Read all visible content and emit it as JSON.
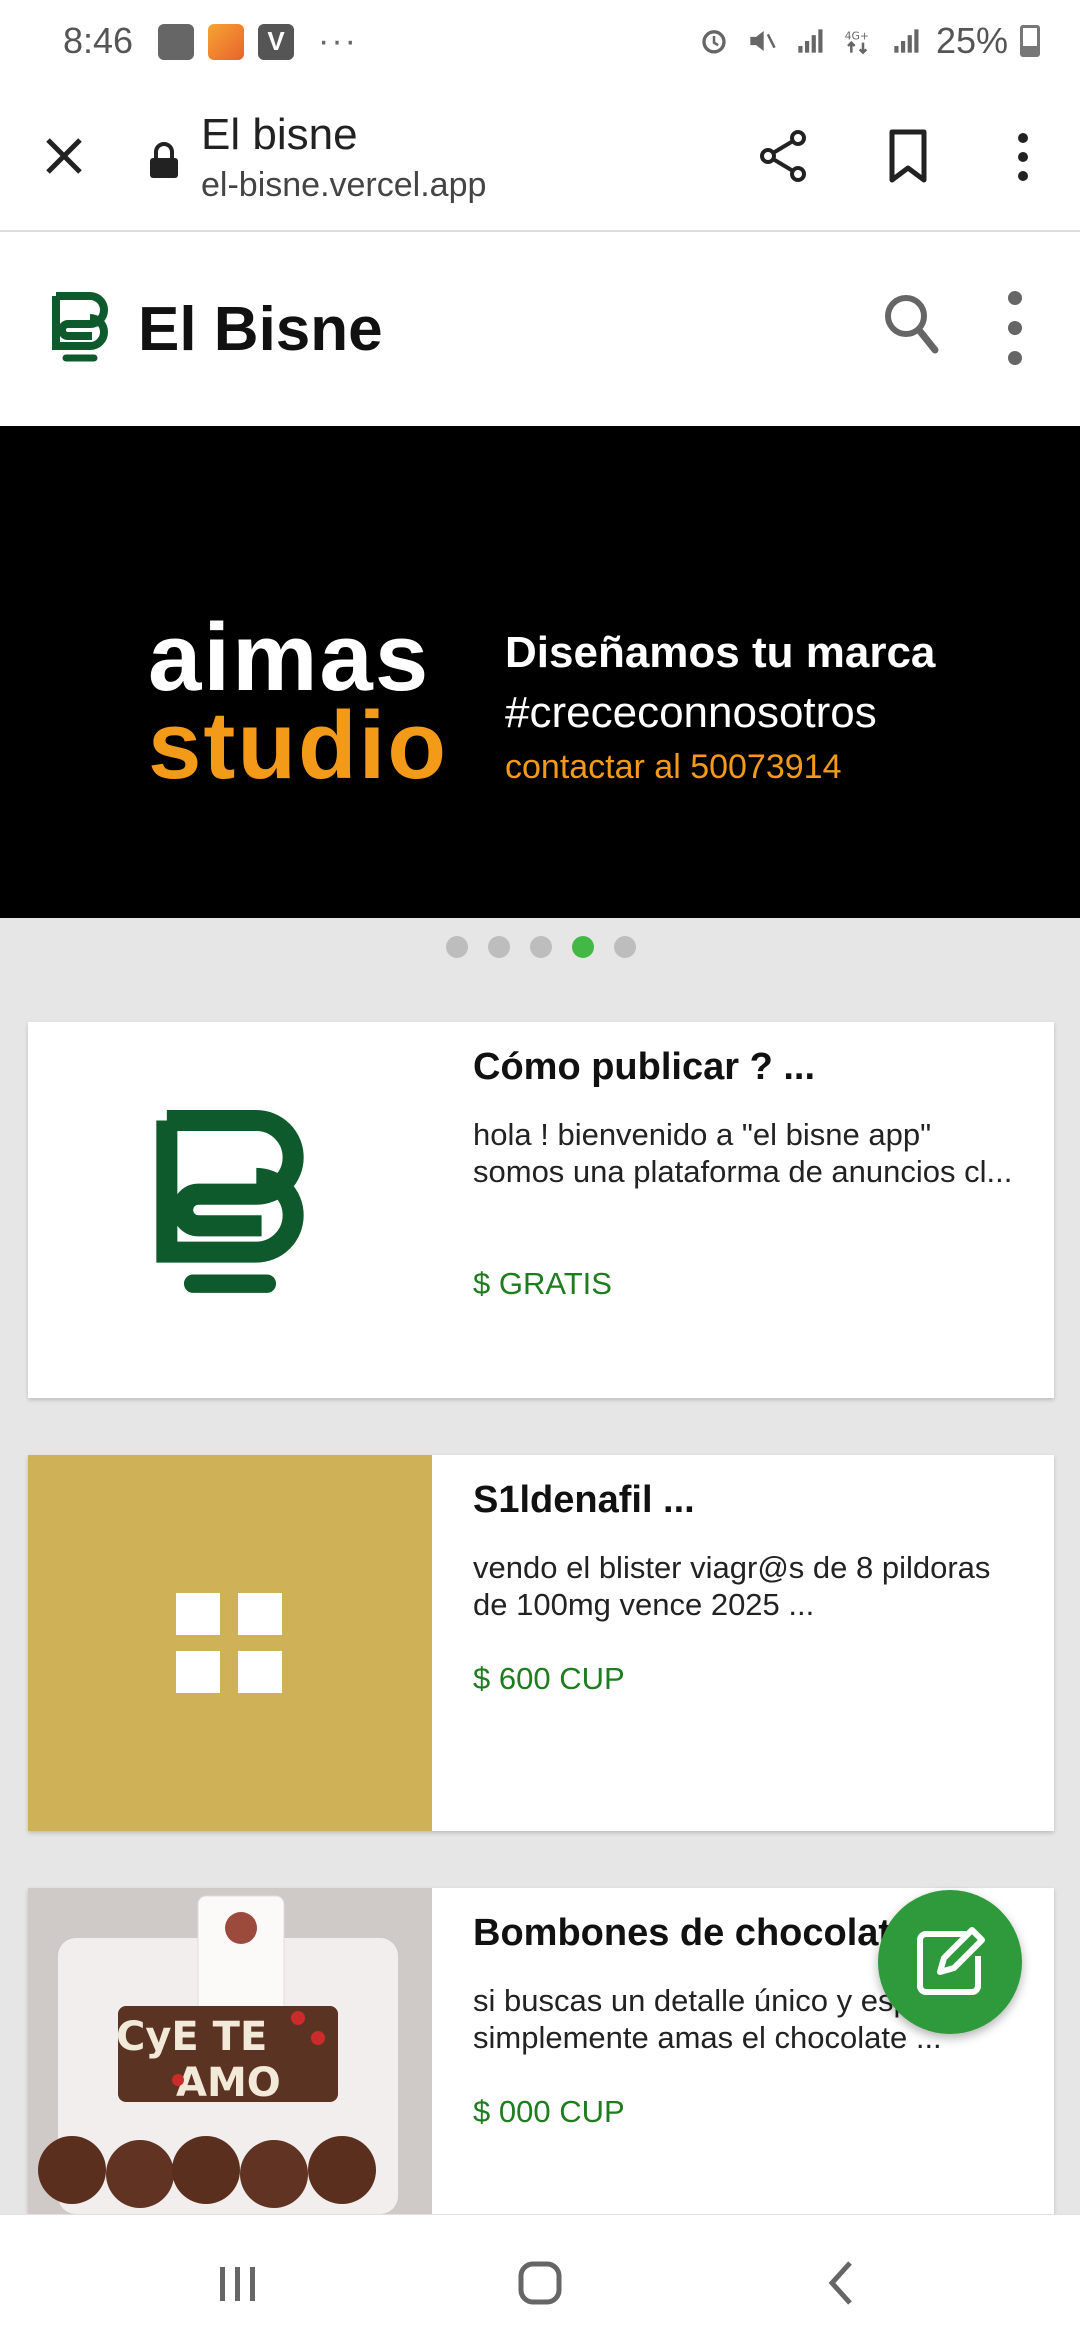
{
  "status_bar": {
    "time": "8:46",
    "battery": "25%",
    "dots": "···"
  },
  "browser": {
    "page_title": "El bisne",
    "url": "el-bisne.vercel.app"
  },
  "header": {
    "app_title": "El Bisne"
  },
  "banner": {
    "brand_line1": "aimas",
    "brand_line2": "studio",
    "line1": "Diseñamos tu marca",
    "line2": "#crececonnosotros",
    "line3": "contactar al 50073914"
  },
  "carousel": {
    "count": 5,
    "active_index": 3
  },
  "listings": [
    {
      "title": "Cómo publicar ? ...",
      "description": "hola ! bienvenido a \"el bisne app\" somos una plataforma de anuncios cl...",
      "price": "$ GRATIS",
      "image": "el-bisne-logo"
    },
    {
      "title": "S1ldenafil ...",
      "description": "vendo el blister viagr@s de 8 pildoras de 100mg vence 2025 ...",
      "price": "$ 600 CUP",
      "image": "category-grid-icon"
    },
    {
      "title": "Bombones de chocolat...",
      "description": "si buscas un detalle único y esp... simplemente amas el chocolate ...",
      "price": "$ 000 CUP",
      "image": "chocolate-photo"
    }
  ],
  "colors": {
    "brand_green": "#0f5a2c",
    "price_green": "#1e7d1e",
    "fab_green": "#2e9a3c",
    "banner_orange": "#f39a18",
    "card2_bg": "#cfb257"
  }
}
